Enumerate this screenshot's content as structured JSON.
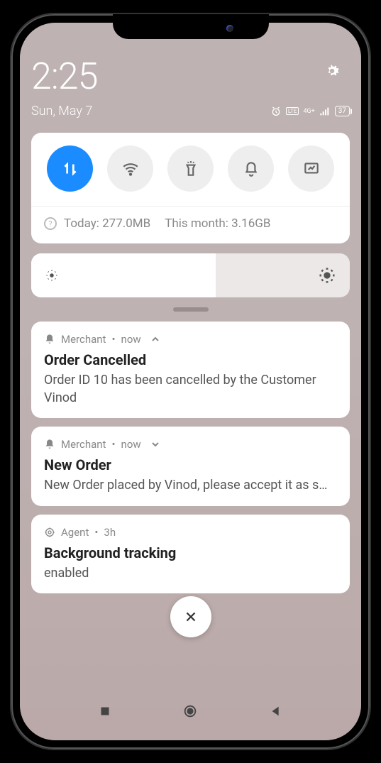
{
  "clock": "2:25",
  "date": "Sun, May 7",
  "battery": "37",
  "data_usage": {
    "today": "Today: 277.0MB",
    "month": "This month: 3.16GB"
  },
  "notifications": [
    {
      "app": "Merchant",
      "time": "now",
      "title": "Order Cancelled",
      "body": "Order ID 10 has been cancelled by the Customer Vinod",
      "expanded": true
    },
    {
      "app": "Merchant",
      "time": "now",
      "title": "New Order",
      "body": "New Order placed by Vinod, please accept it as s…",
      "expanded": false
    },
    {
      "app": "Agent",
      "time": "3h",
      "title": "Background tracking",
      "body": "enabled",
      "expanded": null
    }
  ]
}
